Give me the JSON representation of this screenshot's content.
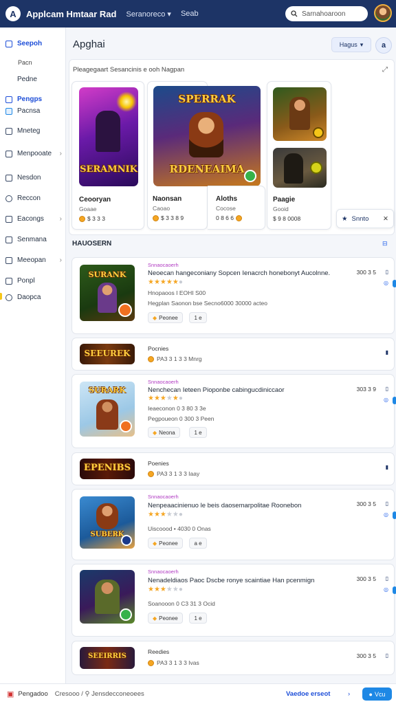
{
  "topbar": {
    "logo": "A",
    "brand": "Applcam Hmtaar Rad",
    "nav": [
      "Seranoreco ▾",
      "Seab"
    ],
    "search_placeholder": "Sarnahoaroon"
  },
  "sidebar": {
    "items": [
      {
        "label": "Seepoh",
        "active": true
      },
      {
        "label": "Pedne",
        "active": false
      },
      {
        "label": "Pengps",
        "active": true
      },
      {
        "label": "Mneteg",
        "active": false
      },
      {
        "label": "Menpooate",
        "active": false
      },
      {
        "label": "Nesdon",
        "active": false
      },
      {
        "label": "Reccon",
        "active": false
      },
      {
        "label": "Eacongs",
        "active": false
      },
      {
        "label": "Senmana",
        "active": false
      },
      {
        "label": "Meeopan",
        "active": false
      },
      {
        "label": "Ponpl",
        "active": false
      },
      {
        "label": "Daopca",
        "active": false
      }
    ],
    "subs": [
      "Pacn",
      "Pacnsa"
    ]
  },
  "header": {
    "title": "Apghai",
    "sort_label": "Hagus",
    "user_initial": "a"
  },
  "featured": {
    "heading": "Pleagegaart Sesancinis e ooh Nagpan",
    "cards": [
      {
        "title": "Ceooryan",
        "sub": "Goaae",
        "price": "$ 3 3 3",
        "art_text": "SERAMNIK"
      },
      {
        "title": "Naonsan",
        "sub": "Caoao",
        "price": "$ 3 3 8 9",
        "art_text": "RDENEAIMA",
        "art_top": "SPERRAK"
      },
      {
        "title": "Aloths",
        "sub": "Cocose",
        "price": "0 8 6 6"
      },
      {
        "title": "Paagie",
        "sub": "Gooid",
        "price": "$ 9 8 0008"
      }
    ]
  },
  "toast": {
    "label": "Snnto"
  },
  "list": {
    "title": "HAUOSERN",
    "rows": [
      {
        "type": "full",
        "tag": "Snnaocaoerh",
        "title": "Neoecan hangeconiany Sopcen Ienacrch honebonyt Aucolnne.",
        "rating": 5,
        "meta": "Hnopaoos I EOHI S00",
        "meta2": "Hegplan Saonon bse Secno6000 30000 acteo",
        "chip": "Peonee",
        "chip2": "1 e",
        "price": "300 3 5"
      },
      {
        "type": "compact",
        "label": "Pocnies",
        "sub": "PA3 3 1 3 3 Mnrg"
      },
      {
        "type": "full",
        "tag": "Snnaocaoerh",
        "title": "Nenchecan Ieteen Pioponbe cabingucdiniccaor",
        "rating": 3,
        "meta": "Ieaeconon 0 3 80 3 3e",
        "meta2": "Pegpoueon 0 300 3 Peen",
        "chip": "Neona",
        "chip2": "1 e",
        "price": "303 3 9"
      },
      {
        "type": "compact",
        "label": "Poenies",
        "sub": "PA3 3 1 3 3 Iaay"
      },
      {
        "type": "full",
        "tag": "Snnaocaoerh",
        "title": "Nenpeaacinienuo le beis daosemarpolitae Roonebon",
        "rating": 3,
        "meta": "Uiscoood • 4030 0 Onas",
        "chip": "Peonee",
        "chip2": "a e",
        "price": "300 3 5"
      },
      {
        "type": "full",
        "tag": "Snnaocaoerh",
        "title": "Nenadeldiaos Paoc Dscbe ronye scaintiae Han pcenmign",
        "rating": 3,
        "meta": "Soanooon 0 C3 31 3 Ocid",
        "chip": "Peonee",
        "chip2": "1 e",
        "price": "300 3 5"
      },
      {
        "type": "compact",
        "label": "Reedies",
        "sub": "PA3 3 1 3 3 Ivas"
      }
    ]
  },
  "bottombar": {
    "left_label": "Pengadoo",
    "path": "Cresooo / ⚲ Jensdecconeoees",
    "link": "Vaedoe erseot",
    "chevron": "›",
    "button": "Vcu"
  },
  "colors": {
    "topbar": "#1d3466",
    "accent": "#1e88e5",
    "star": "#f5a623",
    "tag": "#b03ac2"
  }
}
